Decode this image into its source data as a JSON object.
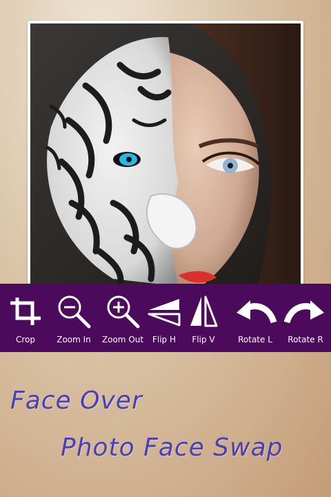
{
  "toolbar": {
    "background": "#4b0a5c",
    "tools": [
      {
        "label": "Crop",
        "icon": "crop-icon"
      },
      {
        "label": "Zoom In",
        "icon": "zoom-in-icon"
      },
      {
        "label": "Zoom Out",
        "icon": "zoom-out-icon"
      },
      {
        "label": "Flip H",
        "icon": "flip-horizontal-icon"
      },
      {
        "label": "Flip V",
        "icon": "flip-vertical-icon"
      },
      {
        "label": "Rotate L",
        "icon": "rotate-left-icon"
      },
      {
        "label": "Rotate R",
        "icon": "rotate-right-icon"
      }
    ]
  },
  "title": {
    "line1": "Face Over",
    "line2": "Photo Face Swap",
    "color": "#4a3fb5"
  },
  "photo": {
    "description_icon": "face-swap-photo"
  }
}
